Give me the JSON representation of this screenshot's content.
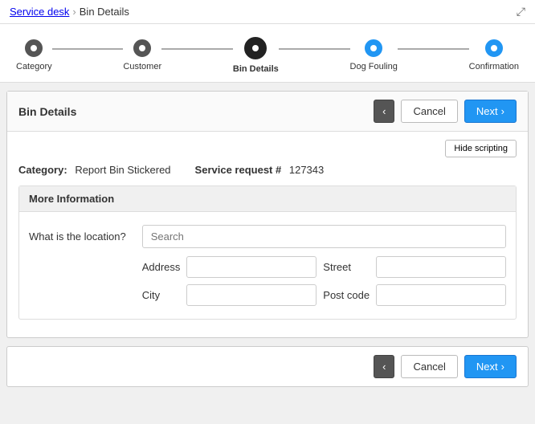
{
  "breadcrumb": {
    "parent": "Service desk",
    "separator": "›",
    "current": "Bin Details"
  },
  "topbar": {
    "expand_icon": "⤢"
  },
  "stepper": {
    "steps": [
      {
        "id": "category",
        "label": "Category",
        "state": "completed"
      },
      {
        "id": "customer",
        "label": "Customer",
        "state": "completed"
      },
      {
        "id": "bin-details",
        "label": "Bin Details",
        "state": "active"
      },
      {
        "id": "dog-fouling",
        "label": "Dog Fouling",
        "state": "upcoming"
      },
      {
        "id": "confirmation",
        "label": "Confirmation",
        "state": "upcoming"
      }
    ]
  },
  "header": {
    "title": "Bin Details",
    "back_button": "‹",
    "cancel_label": "Cancel",
    "next_label": "Next"
  },
  "hide_scripting_label": "Hide scripting",
  "info": {
    "category_label": "Category:",
    "category_value": "Report Bin Stickered",
    "service_request_label": "Service request #",
    "service_request_value": "127343"
  },
  "sections": [
    {
      "id": "more-information",
      "title": "More Information"
    }
  ],
  "location_field": {
    "label": "What is the location?",
    "search_placeholder": "Search",
    "address_label": "Address",
    "street_label": "Street",
    "city_label": "City",
    "postcode_label": "Post code"
  },
  "bottom_bar": {
    "back_button": "‹",
    "cancel_label": "Cancel",
    "next_label": "Next"
  }
}
